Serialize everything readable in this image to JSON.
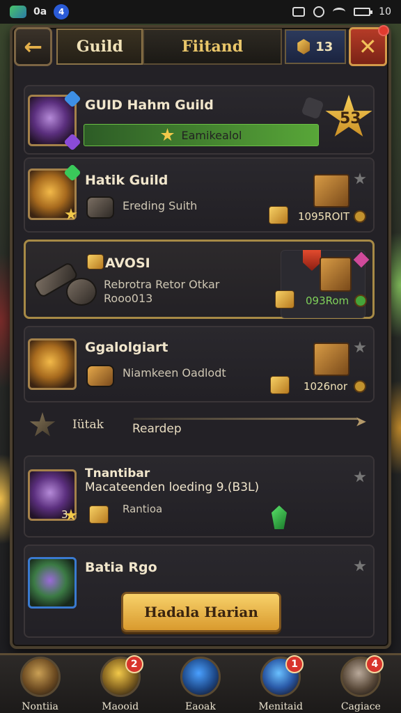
{
  "status_bar": {
    "left_text": "0a",
    "badge": "4",
    "time": "10"
  },
  "header": {
    "tab_guild": "Guild",
    "tab_friend": "Fiitand",
    "currency_value": "13"
  },
  "cards": [
    {
      "title": "GUID Hahm Guild",
      "bar_text": "Eamikealol",
      "rank": "53"
    },
    {
      "title": "Hatik Guild",
      "subtitle": "Ereding Suith",
      "reward": "1095ROIT"
    },
    {
      "title": "AVOSI",
      "line1": "Rebrotra Retor Otkar",
      "line2": "Rooo013",
      "reward": "093Rom"
    },
    {
      "title": "Ggalolgiart",
      "subtitle": "Niamkeen Oadlodt",
      "reward": "1026nor"
    }
  ],
  "divider": {
    "label": "Iütak",
    "search": "Reardep"
  },
  "cards_lower": [
    {
      "title": "Tnantibar",
      "subtitle": "Macateenden loeding 9.(B3L)",
      "item": "Rantioa",
      "badge": "3"
    },
    {
      "title": "Batia Rgo"
    }
  ],
  "action_button": "Hadala Harian",
  "bottom_nav": [
    {
      "label": "Nontiia",
      "badge": ""
    },
    {
      "label": "Maooid",
      "badge": "2"
    },
    {
      "label": "Eaoak",
      "badge": ""
    },
    {
      "label": "Menitaid",
      "badge": "1"
    },
    {
      "label": "Cagiace",
      "badge": "4"
    }
  ],
  "colors": {
    "accent_gold": "#e9c66a",
    "progress_green": "#58a638",
    "badge_red": "#d8342c"
  }
}
